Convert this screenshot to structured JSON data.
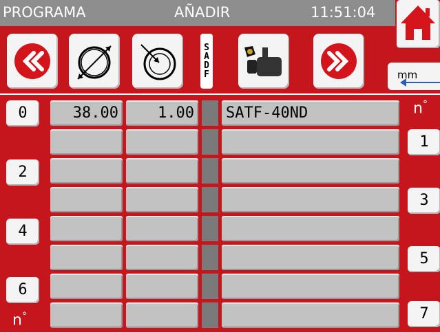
{
  "title_bar": {
    "left": "PROGRAMA",
    "center": "AÑADIR",
    "clock": "11:51:04"
  },
  "toolbar": {
    "prev_icon": "double-left-chevron-icon",
    "diameter_icon": "diameter-icon",
    "inner_diameter_icon": "inner-diameter-icon",
    "sadf_label": [
      "S",
      "A",
      "D",
      "F"
    ],
    "tool_icon": "cutting-tool-icon",
    "next_icon": "double-right-chevron-icon",
    "home_icon": "home-icon"
  },
  "unit": {
    "label": "mm"
  },
  "row_numbers_left": [
    "0",
    "2",
    "4",
    "6"
  ],
  "row_numbers_right": [
    "1",
    "3",
    "5",
    "7"
  ],
  "n_label": "n",
  "rows": [
    {
      "col1": "38.00",
      "col2": "1.00",
      "col4": "SATF-40ND"
    },
    {
      "col1": "",
      "col2": "",
      "col4": ""
    },
    {
      "col1": "",
      "col2": "",
      "col4": ""
    },
    {
      "col1": "",
      "col2": "",
      "col4": ""
    },
    {
      "col1": "",
      "col2": "",
      "col4": ""
    },
    {
      "col1": "",
      "col2": "",
      "col4": ""
    },
    {
      "col1": "",
      "col2": "",
      "col4": ""
    },
    {
      "col1": "",
      "col2": "",
      "col4": ""
    }
  ],
  "colors": {
    "background": "#c4161c",
    "titlebar": "#8d8d8d",
    "cell": "#c2c2c2",
    "button": "#f4f4f4"
  }
}
